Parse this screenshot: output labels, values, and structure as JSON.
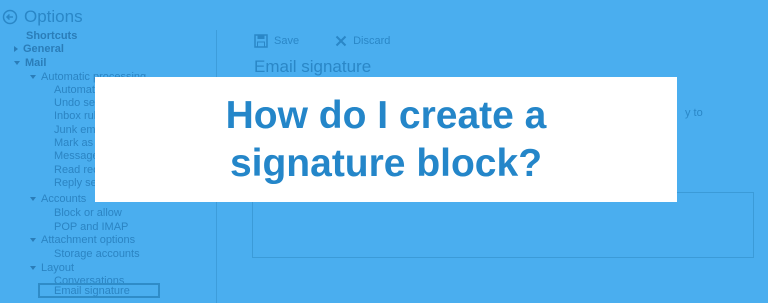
{
  "header": {
    "title": "Options",
    "back_icon": "back-arrow-icon"
  },
  "sidebar": {
    "shortcuts": "Shortcuts",
    "general": "General",
    "mail": "Mail",
    "automatic_processing": "Automatic processing",
    "auto_items": [
      "Automatic replies",
      "Undo send",
      "Inbox rules",
      "Junk email",
      "Mark as read",
      "Message options",
      "Read receipts",
      "Reply settings"
    ],
    "accounts": "Accounts",
    "block_or_allow": "Block or allow",
    "pop_imap": "POP and IMAP",
    "attachment_options": "Attachment options",
    "storage_accounts": "Storage accounts",
    "layout": "Layout",
    "conversations": "Conversations",
    "email_signature": "Email signature"
  },
  "toolbar": {
    "save_label": "Save",
    "discard_label": "Discard"
  },
  "main": {
    "section_title": "Email signature",
    "clipped_text": "y to"
  },
  "overlay": {
    "line1": "How do I create a",
    "line2": "signature block?"
  },
  "colors": {
    "background": "#4aaeef",
    "overlay_text": "#2486c9",
    "overlay_bg": "#ffffff"
  }
}
